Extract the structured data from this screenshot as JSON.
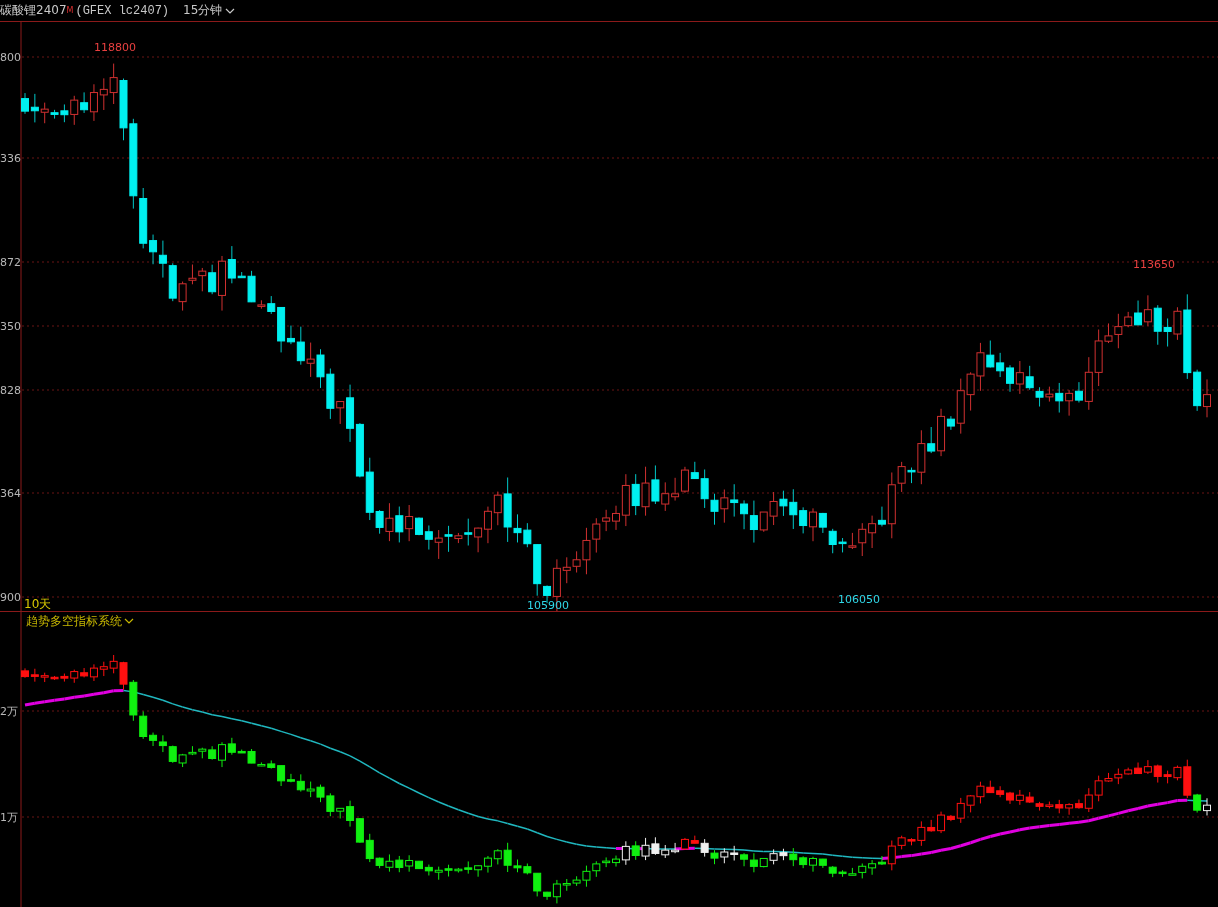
{
  "header": {
    "symbol": "碳酸锂2407",
    "badge": "M",
    "code": "(GFEX lc2407)",
    "period": "15分钟"
  },
  "main_chart": {
    "y_labels": [
      "800",
      "336",
      "872",
      "350",
      "828",
      "364",
      "900"
    ],
    "annotations": [
      {
        "text": "118800",
        "kind": "high"
      },
      {
        "text": "113650",
        "kind": "high"
      },
      {
        "text": "105900",
        "kind": "low"
      },
      {
        "text": "106050",
        "kind": "low"
      }
    ],
    "period_label": "10天"
  },
  "indicator_panel": {
    "title": "趋势多空指标系统",
    "y_labels": [
      "2万",
      "1万"
    ]
  }
}
